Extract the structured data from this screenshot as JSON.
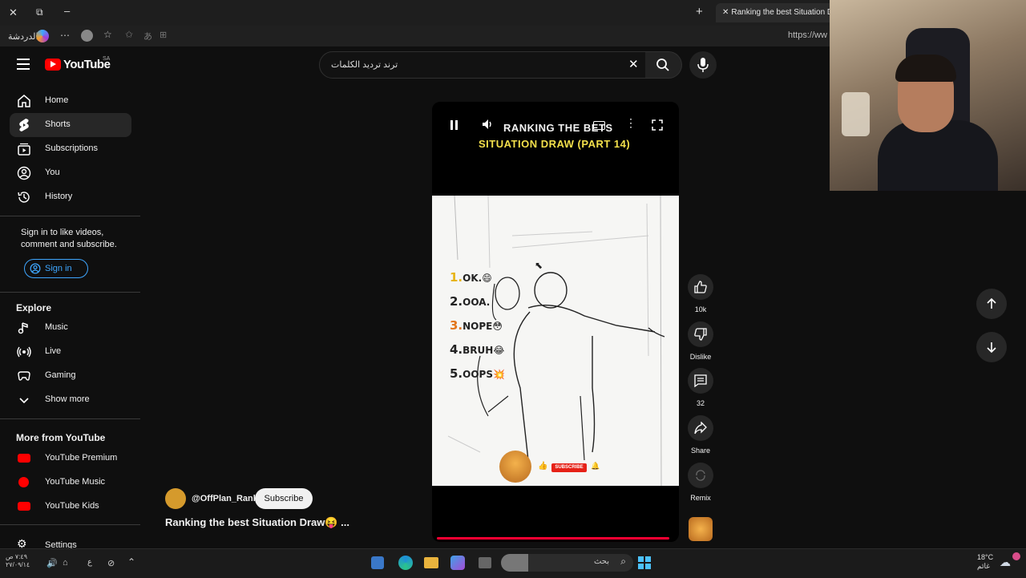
{
  "browser": {
    "tab_title": "Ranking the best Situation Dr",
    "url_partial": "https://ww",
    "chat_label": "الدردشة"
  },
  "header": {
    "logo_text": "YouTube",
    "region": "SA",
    "search_value": "ترند ترديد الكلمات"
  },
  "sidebar": {
    "items": [
      {
        "label": "Home",
        "icon": "home-icon"
      },
      {
        "label": "Shorts",
        "icon": "shorts-icon"
      },
      {
        "label": "Subscriptions",
        "icon": "subscriptions-icon"
      },
      {
        "label": "You",
        "icon": "account-icon"
      },
      {
        "label": "History",
        "icon": "history-icon"
      }
    ],
    "signin_prompt": "Sign in to like videos, comment and subscribe.",
    "signin_button": "Sign in",
    "explore_title": "Explore",
    "explore_items": [
      {
        "label": "Music",
        "icon": "music-icon"
      },
      {
        "label": "Live",
        "icon": "live-icon"
      },
      {
        "label": "Gaming",
        "icon": "gaming-icon"
      },
      {
        "label": "Show more",
        "icon": "chevron-down-icon"
      }
    ],
    "more_title": "More from YouTube",
    "more_items": [
      {
        "label": "YouTube Premium"
      },
      {
        "label": "YouTube Music"
      },
      {
        "label": "YouTube Kids"
      }
    ],
    "settings_label": "Settings"
  },
  "video": {
    "overlay_line1": "RANKING THE BETS",
    "overlay_line2": "SITUATION DRAW (PART 14)",
    "rankings": [
      {
        "n": "1.",
        "text": "OK.😄",
        "color": "#e7b416"
      },
      {
        "n": "2.",
        "text": "OOA.",
        "color": "#222222"
      },
      {
        "n": "3.",
        "text": "NOPE😳",
        "color": "#e2761b"
      },
      {
        "n": "4.",
        "text": "BRUH😂",
        "color": "#222222"
      },
      {
        "n": "5.",
        "text": "OOPS💥",
        "color": "#222222"
      }
    ],
    "subscribe_badge": "SUBSCRIBE",
    "progress_fraction": 0.98
  },
  "actions": {
    "like_count": "10k",
    "dislike_label": "Dislike",
    "comment_count": "32",
    "share_label": "Share",
    "remix_label": "Remix"
  },
  "channel": {
    "handle": "@OffPlan_Rank",
    "subscribe_label": "Subscribe",
    "video_title": "Ranking the best Situation Draw😝 ..."
  },
  "taskbar": {
    "search_label": "بحث",
    "time": "٧:٤٩ ص",
    "date": "٢٧/٠٩/١٤",
    "temperature": "18°C",
    "weather_text": "غائم"
  },
  "colors": {
    "yt_red": "#ff0000",
    "accent_blue": "#3ea6ff",
    "background": "#0f0f0f"
  }
}
